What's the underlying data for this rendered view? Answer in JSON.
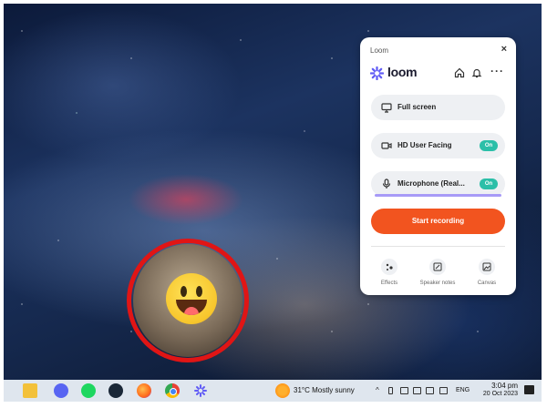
{
  "loom_panel": {
    "window_title": "Loom",
    "logo_text": "loom",
    "options": {
      "screen": {
        "label": "Full screen",
        "icon": "monitor-icon"
      },
      "camera": {
        "label": "HD User Facing",
        "status": "On",
        "icon": "camera-icon"
      },
      "microphone": {
        "label": "Microphone (Real...",
        "status": "On",
        "icon": "microphone-icon"
      }
    },
    "start_label": "Start recording",
    "tools": {
      "effects": "Effects",
      "notes": "Speaker notes",
      "canvas": "Canvas"
    },
    "colors": {
      "accent": "#f2541f",
      "toggle_on": "#2bbfa8",
      "brand": "#625df5"
    }
  },
  "taskbar": {
    "weather": "31°C  Mostly sunny",
    "language": "ENG",
    "time": "3:04 pm",
    "date": "20 Oct 2023",
    "apps": [
      "file-explorer",
      "discord",
      "spotify",
      "steam",
      "firefox",
      "chrome",
      "loom"
    ]
  }
}
